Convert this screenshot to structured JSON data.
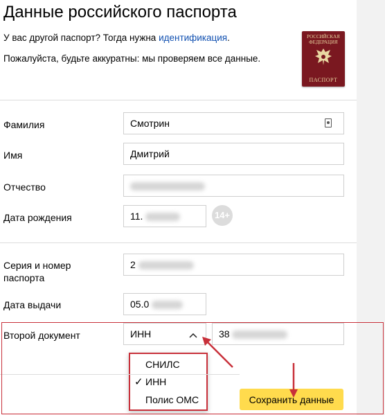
{
  "page": {
    "title": "Данные российского паспорта",
    "other_passport_text": "У вас другой паспорт? Тогда нужна ",
    "other_passport_link": "идентификация",
    "other_passport_end": ".",
    "careful_text": "Пожалуйста, будьте аккуратны: мы проверяем все данные."
  },
  "passport_image": {
    "top_text": "РОССИЙСКАЯ ФЕДЕРАЦИЯ",
    "bottom_text": "ПАСПОРТ",
    "cover_color": "#7a1820"
  },
  "form": {
    "surname": {
      "label": "Фамилия",
      "value": "Смотрин"
    },
    "name": {
      "label": "Имя",
      "value": "Дмитрий"
    },
    "patronymic": {
      "label": "Отчество",
      "value": ""
    },
    "birthdate": {
      "label": "Дата рождения",
      "value": "11.",
      "age_badge": "14+"
    },
    "series_number": {
      "label": "Серия и номер паспорта",
      "value": "2"
    },
    "issue_date": {
      "label": "Дата выдачи",
      "value": "05.0"
    },
    "second_document": {
      "label": "Второй документ",
      "selected": "ИНН",
      "value": "38",
      "options": [
        {
          "label": "СНИЛС",
          "checked": false
        },
        {
          "label": "ИНН",
          "checked": true
        },
        {
          "label": "Полис ОМС",
          "checked": false
        }
      ]
    }
  },
  "save_button": "Сохранить данные",
  "colors": {
    "accent_button": "#ffdb4d",
    "link": "#0f4fb0",
    "annotation_red": "#c8303a"
  }
}
